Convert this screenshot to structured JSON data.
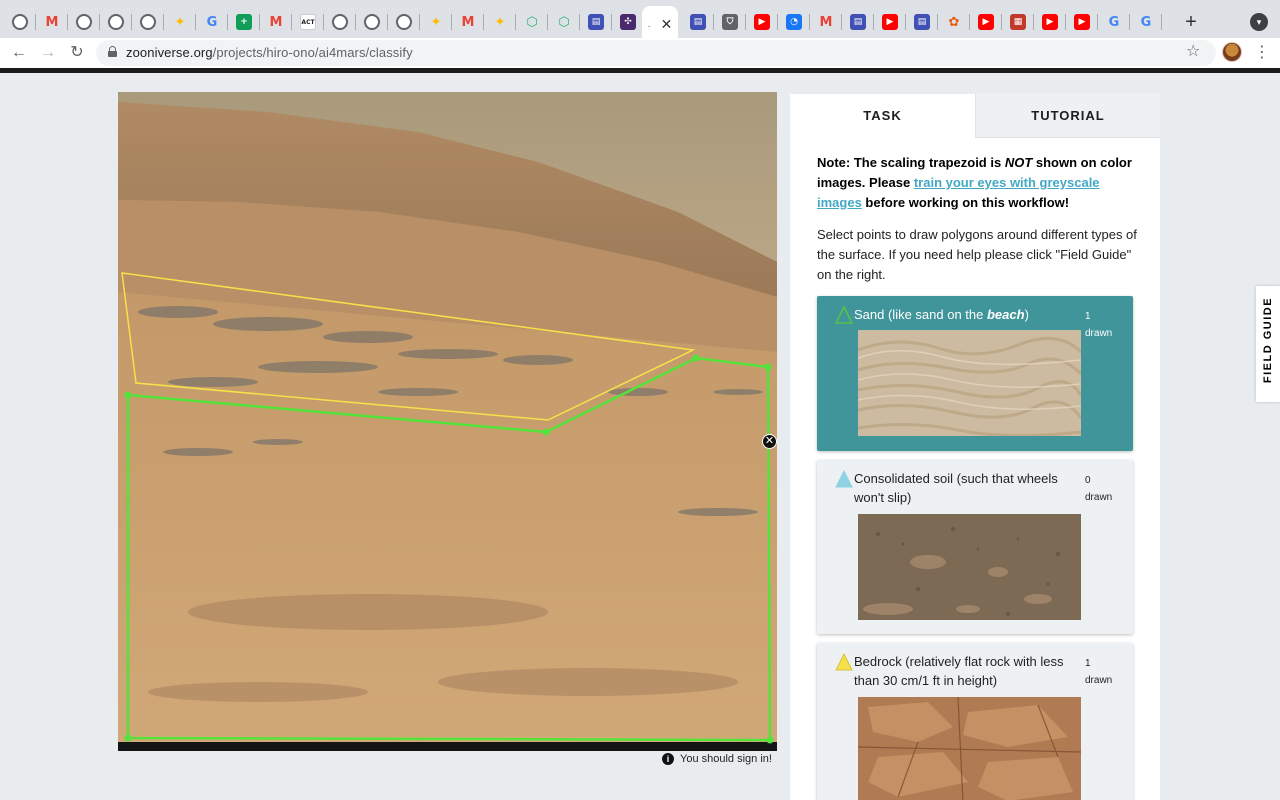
{
  "browser": {
    "tabs": [
      {
        "icon": "globe-icon",
        "color": "#5f6368"
      },
      {
        "icon": "gmail-icon",
        "color": "#ea4335"
      },
      {
        "icon": "globe-icon",
        "color": "#5f6368"
      },
      {
        "icon": "globe-icon",
        "color": "#5f6368"
      },
      {
        "icon": "globe-icon",
        "color": "#5f6368"
      },
      {
        "icon": "pinwheel-icon",
        "color": "#fbbc04"
      },
      {
        "icon": "google-icon",
        "color": "#4285f4"
      },
      {
        "icon": "sheets-icon",
        "color": "#0f9d58"
      },
      {
        "icon": "gmail-icon",
        "color": "#ea4335"
      },
      {
        "icon": "act-icon",
        "color": "#222222"
      },
      {
        "icon": "globe-icon",
        "color": "#5f6368"
      },
      {
        "icon": "globe-icon",
        "color": "#5f6368"
      },
      {
        "icon": "globe-icon",
        "color": "#5f6368"
      },
      {
        "icon": "pinwheel-icon",
        "color": "#fbbc04"
      },
      {
        "icon": "gmail-icon",
        "color": "#ea4335"
      },
      {
        "icon": "pinwheel-icon",
        "color": "#fbbc04"
      },
      {
        "icon": "hexagon-icon",
        "color": "#2bb673"
      },
      {
        "icon": "hexagon-icon",
        "color": "#2bb673"
      },
      {
        "icon": "layout-icon",
        "color": "#3f51b5"
      },
      {
        "icon": "zooniverse-icon",
        "color": "#4b2a6b"
      },
      {
        "icon": "active-tab",
        "color": "#ffffff"
      },
      {
        "icon": "layout-icon",
        "color": "#3f51b5"
      },
      {
        "icon": "shield-icon",
        "color": "#5f6368"
      },
      {
        "icon": "youtube-icon",
        "color": "#ff0000"
      },
      {
        "icon": "messenger-icon",
        "color": "#1877f2"
      },
      {
        "icon": "gmail-icon",
        "color": "#ea4335"
      },
      {
        "icon": "layout-icon",
        "color": "#3f51b5"
      },
      {
        "icon": "youtube-icon",
        "color": "#ff0000"
      },
      {
        "icon": "layout-icon",
        "color": "#3f51b5"
      },
      {
        "icon": "paw-icon",
        "color": "#e8590c"
      },
      {
        "icon": "youtube-icon",
        "color": "#ff0000"
      },
      {
        "icon": "thumbnail-icon",
        "color": "#c0392b"
      },
      {
        "icon": "youtube-icon",
        "color": "#ff0000"
      },
      {
        "icon": "youtube-icon",
        "color": "#ff0000"
      },
      {
        "icon": "google-icon",
        "color": "#4285f4"
      },
      {
        "icon": "google-icon",
        "color": "#4285f4"
      }
    ],
    "new_tab_label": "+",
    "url_host": "zooniverse.org",
    "url_path": "/projects/hiro-ono/ai4mars/classify"
  },
  "task_panel": {
    "tab_task": "TASK",
    "tab_tutorial": "TUTORIAL",
    "note_prefix": "Note: The scaling trapezoid is ",
    "note_emph": "NOT",
    "note_mid": " shown on color images. Please ",
    "note_link": "train your eyes with greyscale images",
    "note_suffix": " before working on this workflow!",
    "instructions": "Select points to draw polygons around different types of the surface. If you need help please click \"Field Guide\" on the right.",
    "tools": [
      {
        "label_main": "Sand (like sand on the ",
        "label_emph": "beach",
        "label_end": ")",
        "count": "1",
        "count_label": "drawn",
        "color": "#54c24a",
        "selected": true
      },
      {
        "label_main": "Consolidated soil (such that wheels won't slip)",
        "label_emph": "",
        "label_end": "",
        "count": "0",
        "count_label": "drawn",
        "color": "#7fcfe0",
        "selected": false
      },
      {
        "label_main": "Bedrock (relatively flat rock with less than 30 cm/1 ft in height)",
        "label_emph": "",
        "label_end": "",
        "count": "1",
        "count_label": "drawn",
        "color": "#f4e04d",
        "selected": false
      }
    ]
  },
  "subject": {
    "sand_polygon_color": "#54e33a",
    "bedrock_polygon_color": "#f5e14a",
    "delete_symbol": "✕"
  },
  "signin_text": "You should sign in!",
  "field_guide_label": "FIELD GUIDE"
}
